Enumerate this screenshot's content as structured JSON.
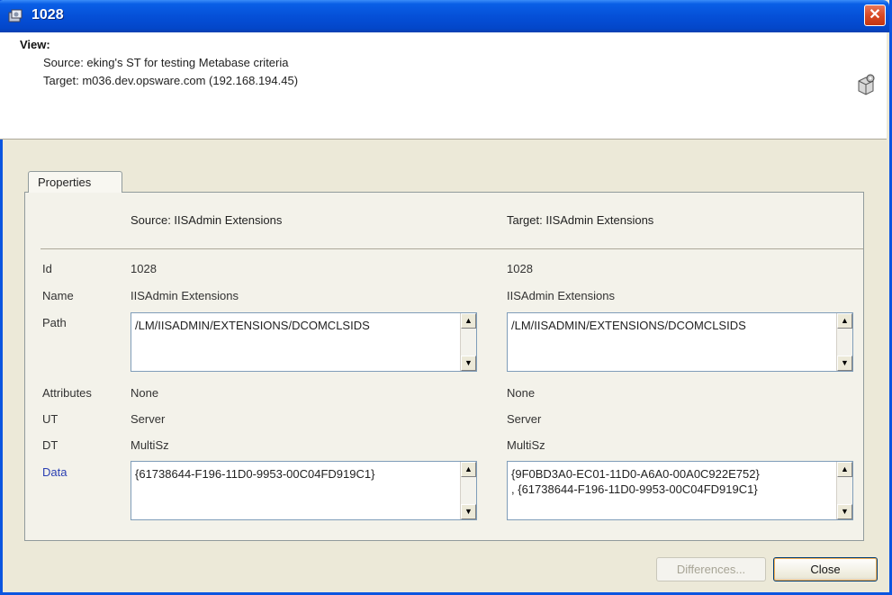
{
  "window": {
    "title": "1028",
    "close_glyph": "✕"
  },
  "header": {
    "label": "View:",
    "source_line": "Source: eking's ST for testing Metabase criteria",
    "target_line": "Target: m036.dev.opsware.com (192.168.194.45)"
  },
  "tabs": [
    {
      "label": "Properties"
    }
  ],
  "columns": {
    "source_header": "Source: IISAdmin Extensions",
    "target_header": "Target: IISAdmin Extensions"
  },
  "rows": {
    "id": {
      "label": "Id",
      "source": "1028",
      "target": "1028"
    },
    "name": {
      "label": "Name",
      "source": "IISAdmin Extensions",
      "target": "IISAdmin Extensions"
    },
    "path": {
      "label": "Path",
      "source": "/LM/IISADMIN/EXTENSIONS/DCOMCLSIDS",
      "target": "/LM/IISADMIN/EXTENSIONS/DCOMCLSIDS"
    },
    "attributes": {
      "label": "Attributes",
      "source": "None",
      "target": "None"
    },
    "ut": {
      "label": "UT",
      "source": "Server",
      "target": "Server"
    },
    "dt": {
      "label": "DT",
      "source": "MultiSz",
      "target": "MultiSz"
    },
    "data": {
      "label": "Data",
      "source": "{61738644-F196-11D0-9953-00C04FD919C1}",
      "target": "{9F0BD3A0-EC01-11D0-A6A0-00A0C922E752}\n, {61738644-F196-11D0-9953-00C04FD919C1}"
    }
  },
  "buttons": {
    "differences": "Differences...",
    "close": "Close"
  },
  "colors": {
    "titlebar": "#0550d8",
    "data_label": "#2a3fb3",
    "close_button": "#d94a25"
  },
  "icons": {
    "title": "app-icon",
    "header": "gear-cube-icon"
  }
}
